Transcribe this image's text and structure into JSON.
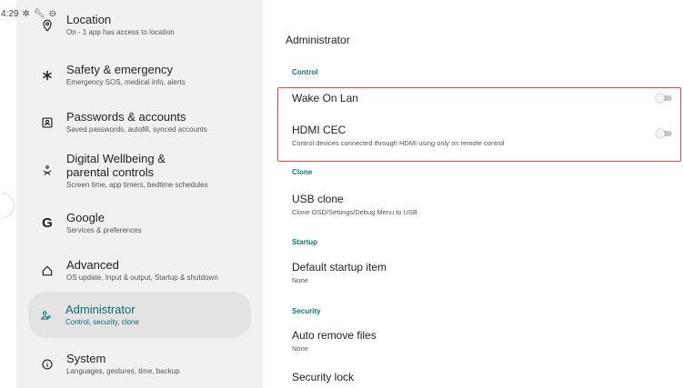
{
  "status_bar": {
    "time": "4:29",
    "icons": [
      "gear-icon",
      "wrench-icon",
      "data-saver-icon"
    ],
    "wifi_icon": "wifi-icon"
  },
  "sidebar": {
    "items": [
      {
        "title": "Location",
        "subtitle": "On - 1 app has access to location",
        "icon": "location-pin-icon"
      },
      {
        "title": "Safety & emergency",
        "subtitle": "Emergency SOS, medical info, alerts",
        "icon": "asterisk-icon"
      },
      {
        "title": "Passwords & accounts",
        "subtitle": "Saved passwords, autofill, synced accounts",
        "icon": "account-box-icon"
      },
      {
        "title": "Digital Wellbeing & parental controls",
        "subtitle": "Screen time, app timers, bedtime schedules",
        "icon": "wellbeing-icon"
      },
      {
        "title": "Google",
        "subtitle": "Services & preferences",
        "icon": "google-g-icon"
      },
      {
        "title": "Advanced",
        "subtitle": "OS update, Input & output, Startup & shutdown",
        "icon": "star-outline-icon"
      },
      {
        "title": "Administrator",
        "subtitle": "Control, security, clone",
        "icon": "admin-people-icon",
        "selected": true
      },
      {
        "title": "System",
        "subtitle": "Languages, gestures, time, backup",
        "icon": "info-icon"
      }
    ]
  },
  "main": {
    "title": "Administrator",
    "sections": {
      "control": "Control",
      "clone": "Clone",
      "startup": "Startup",
      "security": "Security"
    },
    "prefs": {
      "wake_on_lan": {
        "title": "Wake On Lan",
        "enabled": false
      },
      "hdmi_cec": {
        "title": "HDMI CEC",
        "subtitle": "Control devices connected through HDMI using only on remote control",
        "enabled": false
      },
      "usb_clone": {
        "title": "USB clone",
        "subtitle": "Clone OSD/Settings/Debug Menu to USB"
      },
      "default_startup": {
        "title": "Default startup item",
        "subtitle": "None"
      },
      "auto_remove": {
        "title": "Auto remove files",
        "subtitle": "None"
      },
      "security_lock": {
        "title": "Security lock"
      }
    }
  },
  "colors": {
    "accent": "#0b6d75",
    "section_label": "#0f7a72",
    "sidebar_bg": "#f1f1f1",
    "selected_bg": "#e2e3e2",
    "highlight_border": "#e84a4a"
  }
}
